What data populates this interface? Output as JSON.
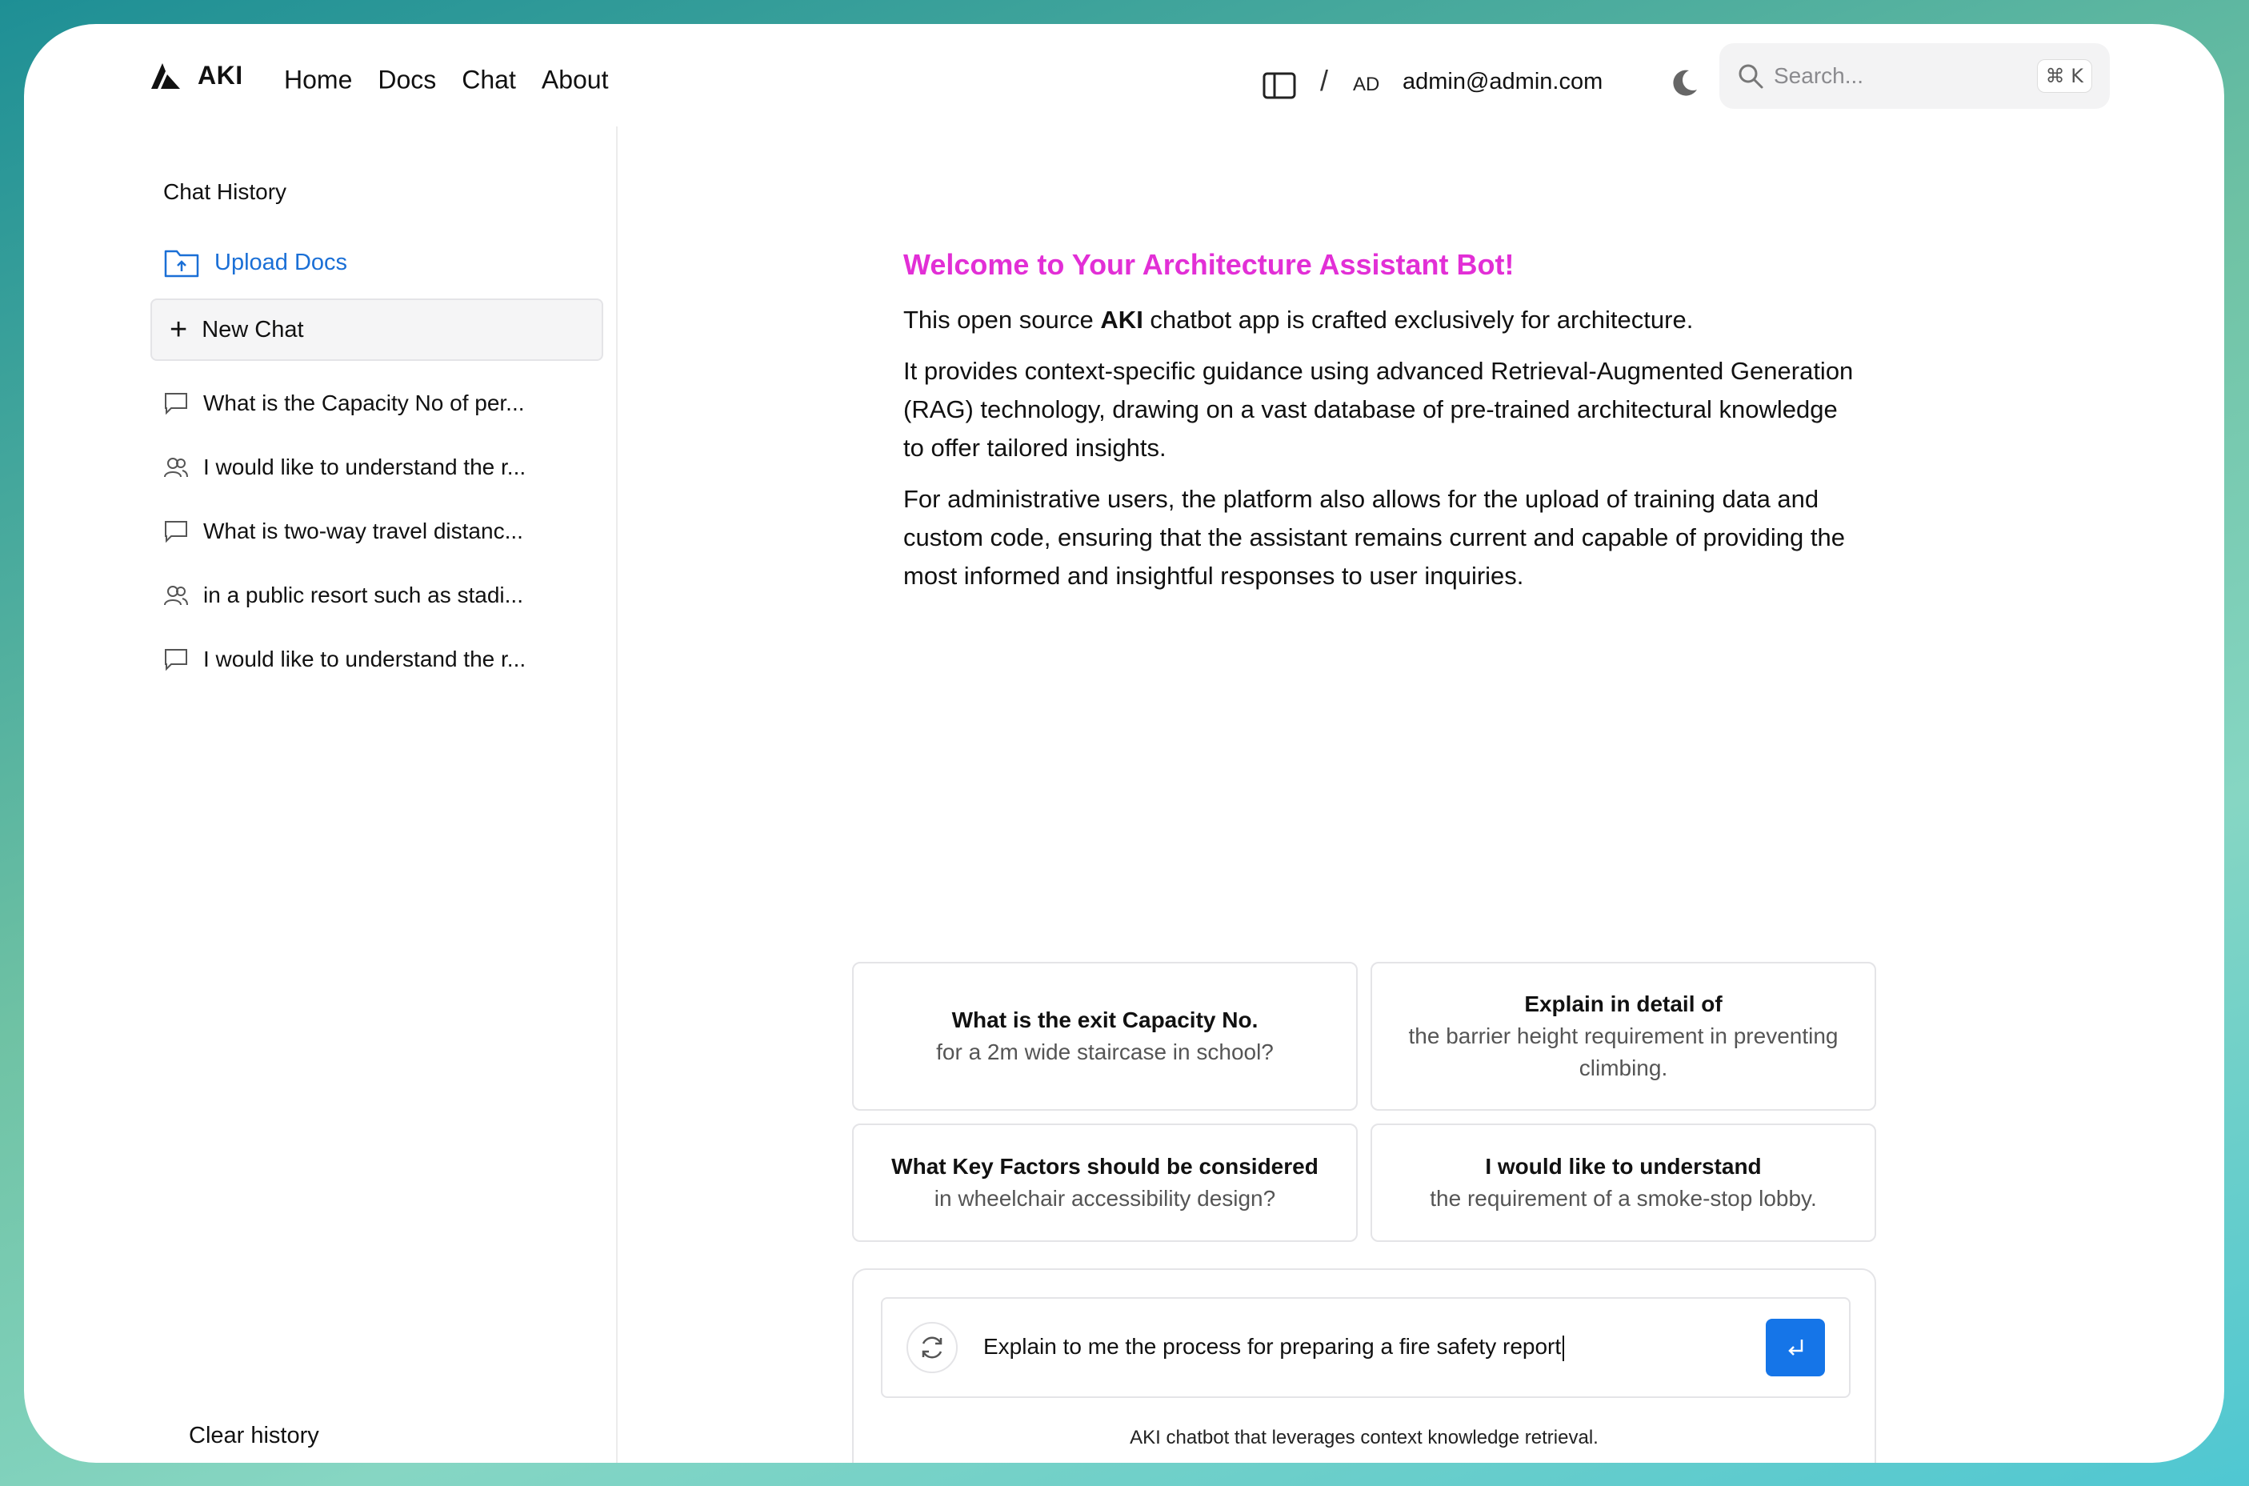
{
  "header": {
    "brand": "AKI",
    "nav": [
      "Home",
      "Docs",
      "Chat",
      "About"
    ],
    "slash": "/",
    "avatar_initials": "AD",
    "email": "admin@admin.com",
    "search_placeholder": "Search...",
    "search_shortcut": "⌘ K"
  },
  "sidebar": {
    "title": "Chat History",
    "upload_label": "Upload Docs",
    "new_chat_label": "New Chat",
    "history": [
      {
        "label": "What is the Capacity No of per...",
        "icon": "message-icon"
      },
      {
        "label": "I would like to understand the r...",
        "icon": "users-icon"
      },
      {
        "label": "What is two-way travel distanc...",
        "icon": "message-icon"
      },
      {
        "label": "in a public resort such as stadi...",
        "icon": "users-icon"
      },
      {
        "label": "I would like to understand the r...",
        "icon": "message-icon"
      }
    ],
    "clear_label": "Clear history"
  },
  "welcome": {
    "title": "Welcome to Your Architecture Assistant Bot!",
    "p1_before": "This open source ",
    "p1_bold": "AKI",
    "p1_after": " chatbot app is crafted exclusively for architecture.",
    "p2": "It provides context-specific guidance using advanced Retrieval-Augmented Generation (RAG) technology, drawing on a vast database of pre-trained architectural knowledge to offer tailored insights.",
    "p3": "For administrative users, the platform also allows for the upload of training data and custom code, ensuring that the assistant remains current and capable of providing the most informed and insightful responses to user inquiries."
  },
  "suggestions": [
    {
      "title": "What is the exit Capacity No.",
      "subtitle": "for a 2m wide staircase in school?"
    },
    {
      "title": "Explain in detail of",
      "subtitle": "the barrier height requirement in preventing climbing."
    },
    {
      "title": "What Key Factors should be considered",
      "subtitle": "in wheelchair accessibility design?"
    },
    {
      "title": "I would like to understand",
      "subtitle": "the requirement of a smoke-stop lobby."
    }
  ],
  "composer": {
    "input_value": "Explain to me the process for preparing a fire safety report",
    "footer": "AKI chatbot that leverages context knowledge retrieval."
  },
  "colors": {
    "accent_blue": "#1575e8",
    "welcome_magenta": "#e22fd6",
    "upload_blue": "#1a6fd6"
  }
}
